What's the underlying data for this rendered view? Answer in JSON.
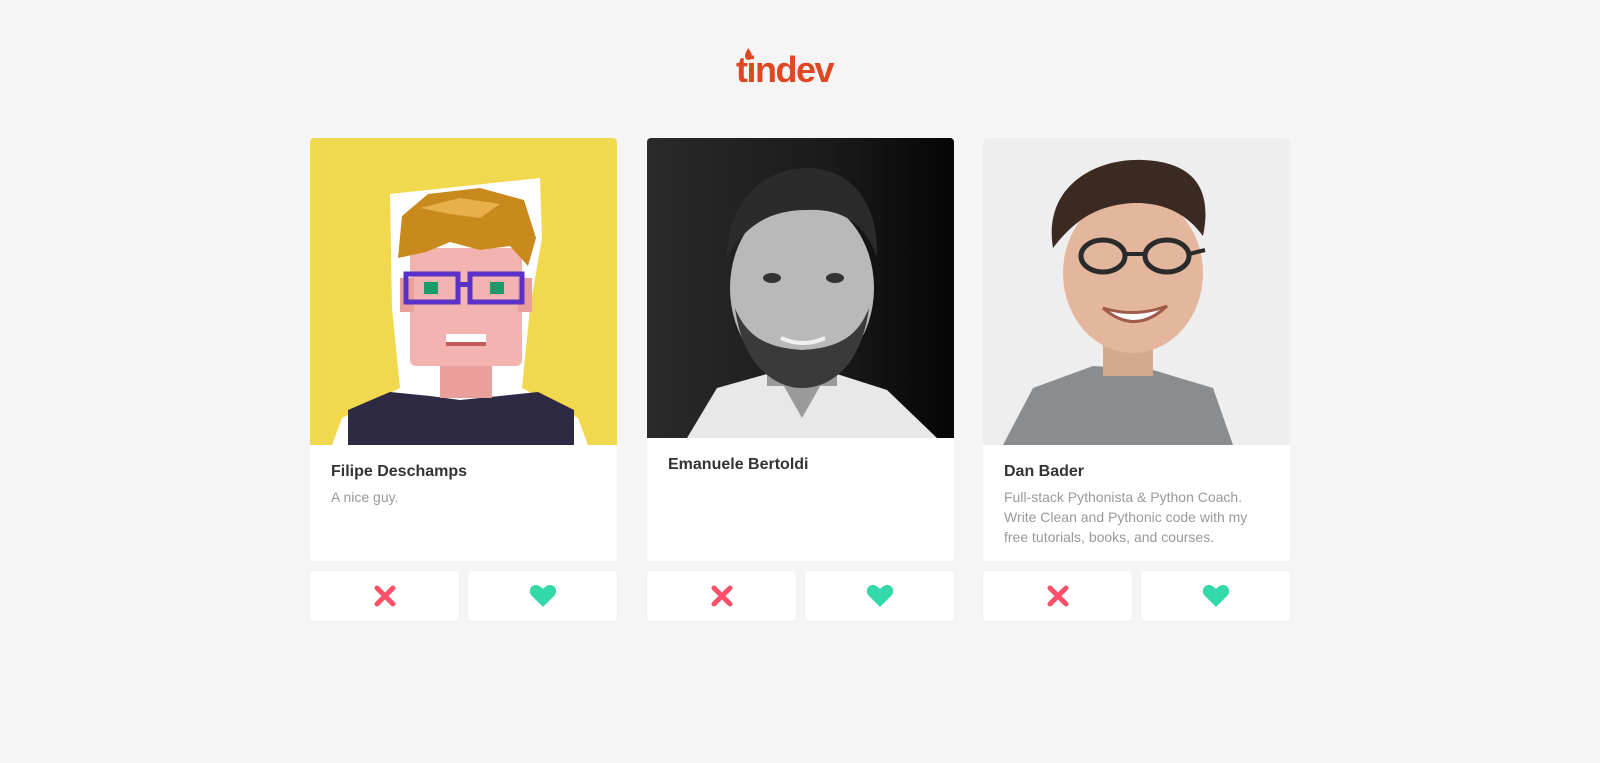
{
  "app": {
    "logo_text": "tindev"
  },
  "colors": {
    "brand": "#df4723",
    "dislike": "#fe5068",
    "like": "#34d9a9",
    "background": "#f5f5f5",
    "name": "#333333",
    "bio": "#999999"
  },
  "developers": [
    {
      "name": "Filipe Deschamps",
      "bio": "A nice guy.",
      "photo": "pixel-art-avatar",
      "dislike_icon": "close-icon",
      "like_icon": "heart-icon"
    },
    {
      "name": "Emanuele Bertoldi",
      "bio": "",
      "photo": "grayscale-portrait",
      "dislike_icon": "close-icon",
      "like_icon": "heart-icon"
    },
    {
      "name": "Dan Bader",
      "bio": "Full-stack Pythonista & Python Coach. Write Clean and Pythonic code with my free tutorials, books, and courses.",
      "photo": "portrait-photo",
      "dislike_icon": "close-icon",
      "like_icon": "heart-icon"
    }
  ]
}
